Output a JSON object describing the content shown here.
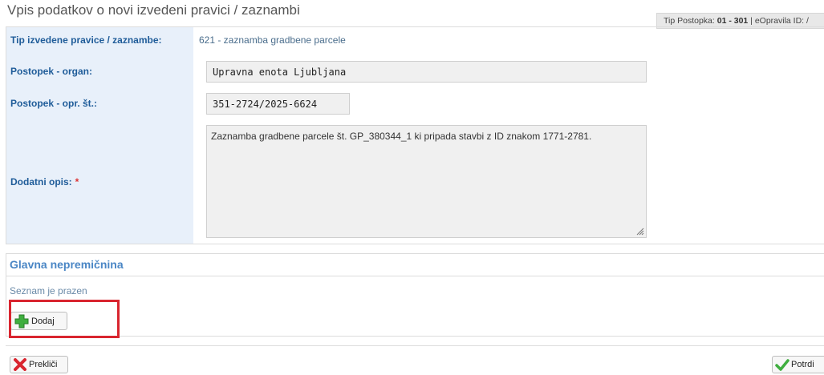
{
  "header": {
    "title": "Vpis podatkov o novi izvedeni pravici / zaznambi",
    "tip_prefix": "Tip Postopka: ",
    "tip_code": "01 - 301",
    "tip_suffix": " | eOpravila ID: /"
  },
  "form": {
    "tip_label": "Tip izvedene pravice / zaznambe:",
    "tip_value": "621 - zaznamba gradbene parcele",
    "organ_label": "Postopek - organ:",
    "organ_value": "Upravna enota Ljubljana",
    "oprst_label": "Postopek - opr. št.:",
    "oprst_value": "351-2724/2025-6624",
    "opis_label": "Dodatni opis:",
    "opis_required": "*",
    "opis_value": "Zaznamba gradbene parcele št. GP_380344_1 ki pripada stavbi z ID znakom 1771-2781."
  },
  "section": {
    "title": "Glavna nepremičnina",
    "empty_text": "Seznam je prazen",
    "add_label": "Dodaj"
  },
  "footer": {
    "cancel_label": "Prekliči",
    "confirm_label": "Potrdi"
  },
  "colors": {
    "label_bg": "#e8f0fa",
    "label_text": "#1f5c99",
    "highlight": "#d9252f"
  }
}
